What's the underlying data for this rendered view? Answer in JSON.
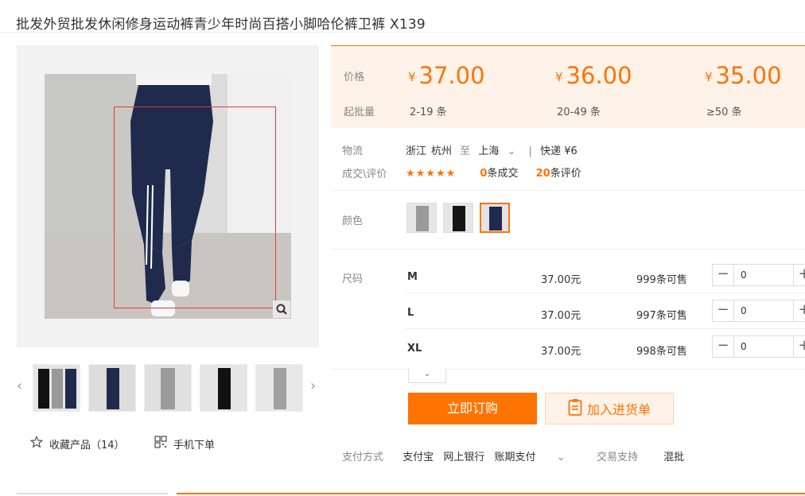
{
  "product": {
    "title": "批发外贸批发休闲修身运动裤青少年时尚百搭小脚哈伦裤卫裤 X139"
  },
  "prices": {
    "price_label": "价格",
    "moq_label": "起批量",
    "currency": "¥",
    "tiers": [
      {
        "price": "37.00",
        "range": "2-19 条"
      },
      {
        "price": "36.00",
        "range": "20-49 条"
      },
      {
        "price": "35.00",
        "range": "≥50 条"
      }
    ]
  },
  "logistics": {
    "label": "物流",
    "from_province": "浙江",
    "from_city": "杭州",
    "to_word": "至",
    "to_city": "上海",
    "shipping": "快递 ¥6"
  },
  "reviews": {
    "label": "成交\\评价",
    "stars": "★★★★★",
    "deals_count": "0",
    "deals_label": "条成交",
    "reviews_count": "20",
    "reviews_label": "条评价"
  },
  "colors": {
    "label": "颜色",
    "selected_index": 2
  },
  "sizes": {
    "label": "尺码",
    "rows": [
      {
        "size": "M",
        "price": "37.00元",
        "stock": "999条可售",
        "qty": "0"
      },
      {
        "size": "L",
        "price": "37.00元",
        "stock": "997条可售",
        "qty": "0"
      },
      {
        "size": "XL",
        "price": "37.00元",
        "stock": "998条可售",
        "qty": "0"
      }
    ]
  },
  "actions": {
    "buy_label": "立即订购",
    "cart_label": "加入进货单"
  },
  "payment": {
    "label": "支付方式",
    "methods": [
      "支付宝",
      "网上银行",
      "账期支付"
    ],
    "trade_label": "交易支持",
    "trade_value": "混批"
  },
  "gallery": {
    "collect_label": "收藏产品（14）",
    "mobile_label": "手机下单"
  },
  "theme": {
    "accent": "#ff7300",
    "accent_bg": "#fff2e8"
  }
}
